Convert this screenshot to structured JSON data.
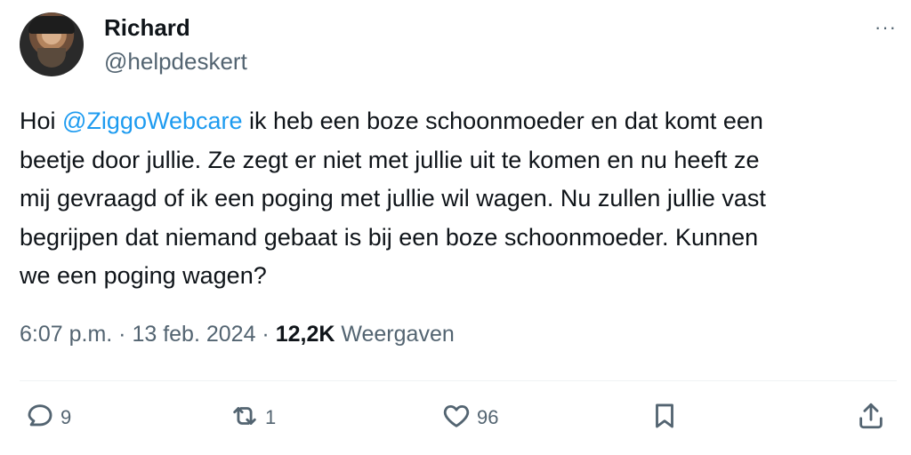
{
  "author": {
    "name": "Richard",
    "handle": "@helpdeskert"
  },
  "menu": {
    "more_label": "···"
  },
  "tweet": {
    "prefix": "Hoi ",
    "mention": "@ZiggoWebcare",
    "body": " ik heb een boze schoonmoeder en dat komt een\nbeetje door jullie. Ze zegt er niet met jullie uit te komen en nu heeft ze\nmij gevraagd of ik een poging met jullie wil wagen. Nu zullen jullie vast\nbegrijpen dat niemand gebaat is bij een boze schoonmoeder. Kunnen\nwe een poging wagen?"
  },
  "meta": {
    "time": "6:07 p.m.",
    "separator": " · ",
    "date": "13 feb. 2024",
    "views_count": "12,2K",
    "views_label": "Weergaven"
  },
  "actions": {
    "reply": {
      "icon": "reply-icon",
      "count": "9"
    },
    "repost": {
      "icon": "repost-icon",
      "count": "1"
    },
    "like": {
      "icon": "heart-icon",
      "count": "96"
    },
    "bookmark": {
      "icon": "bookmark-icon"
    },
    "share": {
      "icon": "share-icon"
    }
  },
  "colors": {
    "link": "#1d9bf0",
    "secondary": "#536471",
    "text": "#0f1419"
  }
}
